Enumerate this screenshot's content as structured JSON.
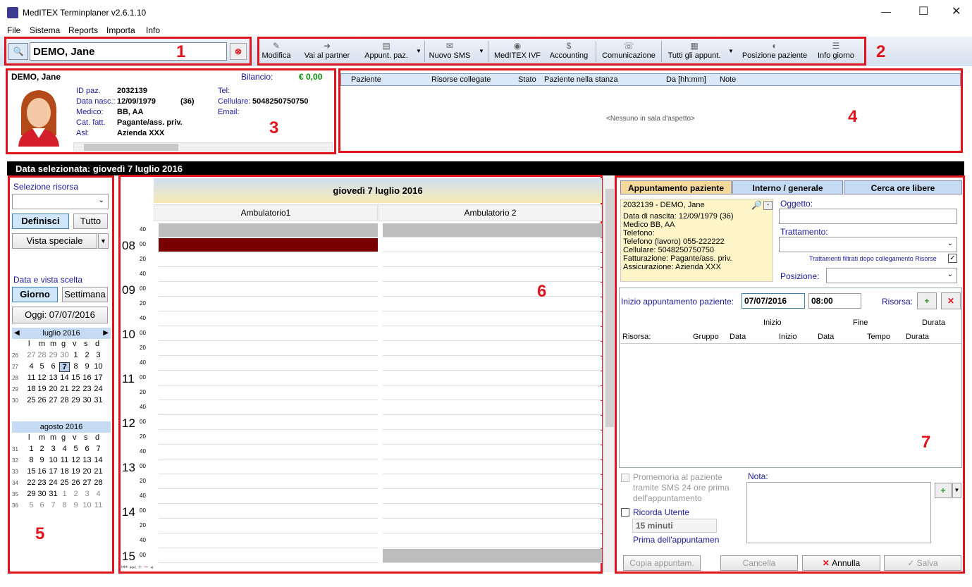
{
  "window": {
    "title": "MedITEX Terminplaner  v2.6.1.10"
  },
  "menu": [
    "File",
    "Sistema",
    "Reports",
    "Importa",
    "Info"
  ],
  "patient_search": {
    "value": "DEMO, Jane"
  },
  "toolbar": [
    "Modifica",
    "Vai al partner",
    "Appunt. paz.",
    "Nuovo SMS",
    "MedITEX IVF",
    "Accounting",
    "Comunicazione",
    "Tutti gli appunt.",
    "Posizione paziente",
    "Info giorno"
  ],
  "annotations": [
    "1",
    "2",
    "3",
    "4",
    "5",
    "6",
    "7"
  ],
  "patient_card": {
    "name": "DEMO, Jane",
    "balance_label": "Bilancio:",
    "balance": "€ 0,00",
    "fields": [
      {
        "label": "ID paz.",
        "value": "2032139"
      },
      {
        "label": "Data nasc.:",
        "value": "12/09/1979",
        "extra": "(36)"
      },
      {
        "label": "Medico:",
        "value": "BB, AA"
      },
      {
        "label": "Cat. fatt.",
        "value": "Pagante/ass. priv."
      },
      {
        "label": "Asl:",
        "value": "Azienda XXX"
      }
    ],
    "contact": [
      {
        "label": "Tel:",
        "value": ""
      },
      {
        "label": "Cellulare:",
        "value": "5048250750750"
      },
      {
        "label": "Email:",
        "value": ""
      }
    ]
  },
  "waiting_room": {
    "columns": [
      "Paziente",
      "Risorse collegate",
      "Stato",
      "Paziente nella stanza",
      "Da [hh:mm]",
      "Note"
    ],
    "empty": "<Nessuno in sala d'aspetto>"
  },
  "selected_date": {
    "label": "Data selezionata:",
    "value": "giovedì 7 luglio 2016"
  },
  "left": {
    "resource_label": "Selezione risorsa",
    "definisci": "Definisci",
    "tutto": "Tutto",
    "vista": "Vista speciale",
    "date_label": "Data e vista scelta",
    "giorno": "Giorno",
    "settimana": "Settimana",
    "oggi": "Oggi: 07/07/2016"
  },
  "cal1": {
    "title": "luglio 2016",
    "days": [
      "l",
      "m",
      "m",
      "g",
      "v",
      "s",
      "d"
    ],
    "weeks": [
      {
        "n": "26",
        "d": [
          "27",
          "28",
          "29",
          "30",
          "1",
          "2",
          "3"
        ]
      },
      {
        "n": "27",
        "d": [
          "4",
          "5",
          "6",
          "7",
          "8",
          "9",
          "10"
        ]
      },
      {
        "n": "28",
        "d": [
          "11",
          "12",
          "13",
          "14",
          "15",
          "16",
          "17"
        ]
      },
      {
        "n": "29",
        "d": [
          "18",
          "19",
          "20",
          "21",
          "22",
          "23",
          "24"
        ]
      },
      {
        "n": "30",
        "d": [
          "25",
          "26",
          "27",
          "28",
          "29",
          "30",
          "31"
        ]
      }
    ]
  },
  "cal2": {
    "title": "agosto 2016",
    "days": [
      "l",
      "m",
      "m",
      "g",
      "v",
      "s",
      "d"
    ],
    "weeks": [
      {
        "n": "31",
        "d": [
          "1",
          "2",
          "3",
          "4",
          "5",
          "6",
          "7"
        ]
      },
      {
        "n": "32",
        "d": [
          "8",
          "9",
          "10",
          "11",
          "12",
          "13",
          "14"
        ]
      },
      {
        "n": "33",
        "d": [
          "15",
          "16",
          "17",
          "18",
          "19",
          "20",
          "21"
        ]
      },
      {
        "n": "34",
        "d": [
          "22",
          "23",
          "24",
          "25",
          "26",
          "27",
          "28"
        ]
      },
      {
        "n": "35",
        "d": [
          "29",
          "30",
          "31",
          "1",
          "2",
          "3",
          "4"
        ]
      },
      {
        "n": "36",
        "d": [
          "5",
          "6",
          "7",
          "8",
          "9",
          "10",
          "11"
        ]
      }
    ]
  },
  "schedule": {
    "title": "giovedì 7 luglio 2016",
    "rooms": [
      "Ambulatorio1",
      "Ambulatorio 2"
    ],
    "slots": [
      {
        "h": "",
        "m": "40"
      },
      {
        "h": "08",
        "m": "00"
      },
      {
        "h": "",
        "m": "20"
      },
      {
        "h": "",
        "m": "40"
      },
      {
        "h": "09",
        "m": "00"
      },
      {
        "h": "",
        "m": "20"
      },
      {
        "h": "",
        "m": "40"
      },
      {
        "h": "10",
        "m": "00"
      },
      {
        "h": "",
        "m": "20"
      },
      {
        "h": "",
        "m": "40"
      },
      {
        "h": "11",
        "m": "00"
      },
      {
        "h": "",
        "m": "20"
      },
      {
        "h": "",
        "m": "40"
      },
      {
        "h": "12",
        "m": "00"
      },
      {
        "h": "",
        "m": "20"
      },
      {
        "h": "",
        "m": "40"
      },
      {
        "h": "13",
        "m": "00"
      },
      {
        "h": "",
        "m": "20"
      },
      {
        "h": "",
        "m": "40"
      },
      {
        "h": "14",
        "m": "00"
      },
      {
        "h": "",
        "m": "20"
      },
      {
        "h": "",
        "m": "40"
      },
      {
        "h": "15",
        "m": "00"
      }
    ]
  },
  "right": {
    "tabs": [
      "Appuntamento paziente",
      "Interno / generale",
      "Cerca ore libere"
    ],
    "info": [
      "2032139 - DEMO, Jane",
      "Data di nascita: 12/09/1979 (36)",
      "Medico BB, AA",
      "Telefono:",
      "Telefono (lavoro) 055-222222",
      "Cellulare: 5048250750750",
      "Fatturazione: Pagante/ass. priv.",
      "Assicurazione: Azienda XXX"
    ],
    "oggetto": "Oggetto:",
    "trattamento": "Trattamento:",
    "filtrati": "Trattamenti filtrati dopo collegamento Risorse",
    "posizione": "Posizione:",
    "inizio_label": "Inizio appuntamento paziente:",
    "date": "07/07/2016",
    "time": "08:00",
    "risorsa": "Risorsa:",
    "grid_top": [
      "Inizio",
      "Fine",
      "Durata"
    ],
    "grid_cols": [
      "Risorsa:",
      "Gruppo",
      "Data",
      "Inizio",
      "Data",
      "Tempo",
      "Durata"
    ],
    "promemoria": "Promemoria al paziente tramite SMS 24 ore prima dell'appuntamento",
    "ricorda": "Ricorda Utente",
    "minuti": "15 minuti",
    "prima": "Prima dell'appuntamen",
    "nota": "Nota:",
    "buttons": [
      "Copia appuntam.",
      "Cancella",
      "Annulla",
      "Salva"
    ]
  }
}
